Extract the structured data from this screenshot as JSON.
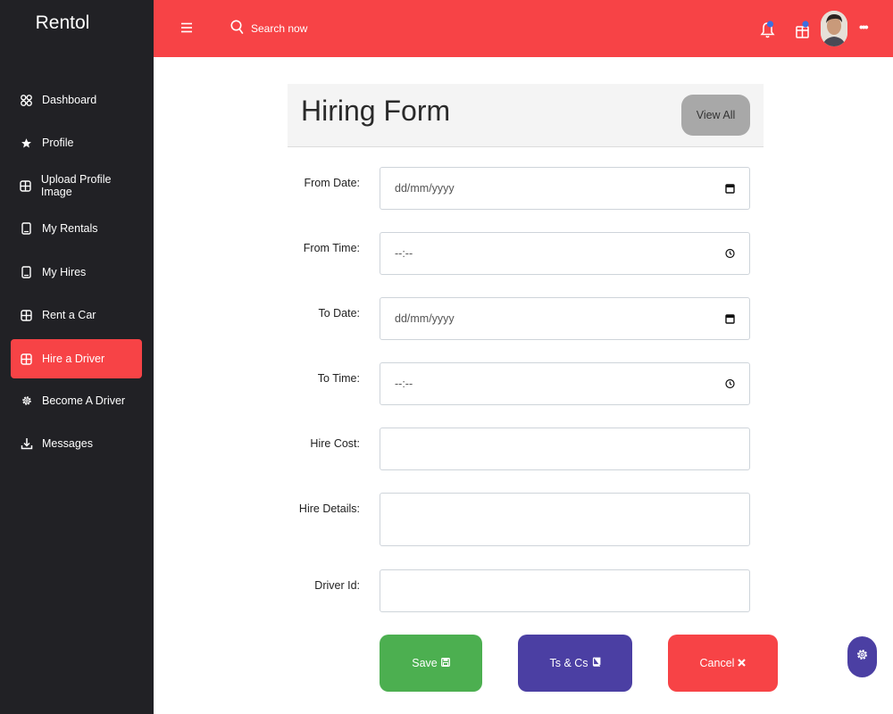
{
  "app": {
    "brand": "Rentol"
  },
  "sidebar": {
    "items": [
      {
        "label": "Dashboard",
        "icon": "dashboard-icon"
      },
      {
        "label": "Profile",
        "icon": "star-icon"
      },
      {
        "label": "Upload Profile Image",
        "icon": "grid-icon"
      },
      {
        "label": "My Rentals",
        "icon": "tablet-icon"
      },
      {
        "label": "My Hires",
        "icon": "tablet-icon"
      },
      {
        "label": "Rent a Car",
        "icon": "grid-icon"
      },
      {
        "label": "Hire a Driver",
        "icon": "grid-icon",
        "active": true
      },
      {
        "label": "Become A Driver",
        "icon": "gear-icon"
      },
      {
        "label": "Messages",
        "icon": "download-icon"
      }
    ]
  },
  "topbar": {
    "search_label": "Search now"
  },
  "card": {
    "title": "Hiring Form",
    "view_all_label": "View All"
  },
  "form": {
    "from_date": {
      "label": "From Date:",
      "value": "dd/mm/yyyy"
    },
    "from_time": {
      "label": "From Time:",
      "value": "--:--"
    },
    "to_date": {
      "label": "To Date:",
      "value": "dd/mm/yyyy"
    },
    "to_time": {
      "label": "To Time:",
      "value": "--:--"
    },
    "hire_cost": {
      "label": "Hire Cost:",
      "value": ""
    },
    "hire_details": {
      "label": "Hire Details:",
      "value": ""
    },
    "driver_id": {
      "label": "Driver Id:",
      "value": ""
    }
  },
  "actions": {
    "save_label": "Save",
    "terms_label": "Ts & Cs",
    "cancel_label": "Cancel"
  },
  "colors": {
    "accent": "#f74346",
    "sidebar_bg": "#212125",
    "save": "#4caf50",
    "terms": "#4b3fa3",
    "view_all": "#a8a8a8"
  }
}
